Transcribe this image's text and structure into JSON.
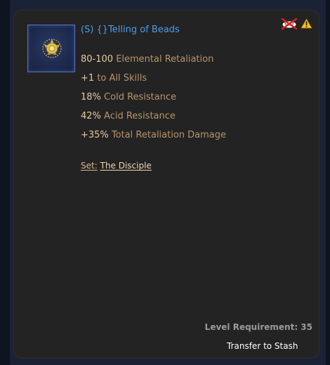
{
  "item": {
    "title": "(S) {}Telling of Beads",
    "icon": "amulet-icon",
    "stats": [
      {
        "value": "80-100",
        "label": "Elemental Retaliation"
      },
      {
        "value": "+1",
        "label": "to All Skills"
      },
      {
        "value": "18%",
        "label": "Cold Resistance"
      },
      {
        "value": "42%",
        "label": "Acid Resistance"
      },
      {
        "value": "+35%",
        "label": "Total Retaliation Damage"
      }
    ],
    "set_label": "Set:",
    "set_name": "The Disciple"
  },
  "flags": {
    "no_trade_icon": "no-trade-icon",
    "warning_icon": "warning-icon"
  },
  "footer": {
    "level_requirement": "Level Requirement: 35",
    "transfer_button": "Transfer to Stash"
  },
  "colors": {
    "title": "#4f9ce8",
    "stat_label": "#b8946a",
    "stat_value": "#e9c9a0",
    "panel_bg": "#232323",
    "page_bg": "#0e1420"
  }
}
